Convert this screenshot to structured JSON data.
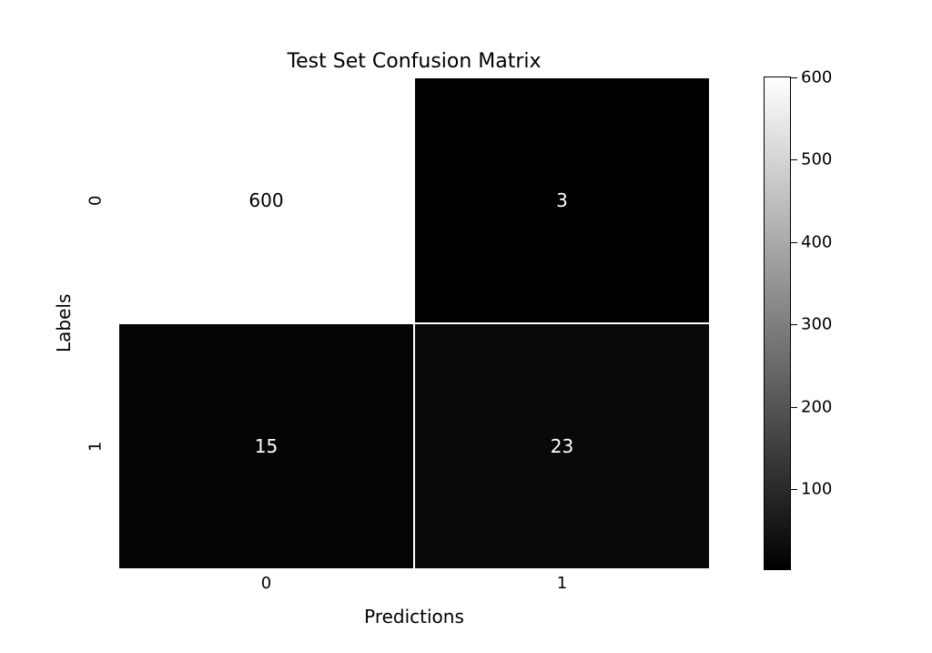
{
  "chart_data": {
    "type": "heatmap",
    "title": "Test Set Confusion Matrix",
    "xlabel": "Predictions",
    "ylabel": "Labels",
    "x_categories": [
      "0",
      "1"
    ],
    "y_categories": [
      "0",
      "1"
    ],
    "values": [
      [
        600,
        3
      ],
      [
        15,
        23
      ]
    ],
    "colorbar": {
      "min": 3,
      "max": 600,
      "ticks": [
        100,
        200,
        300,
        400,
        500,
        600
      ]
    },
    "colormap": "gray"
  }
}
